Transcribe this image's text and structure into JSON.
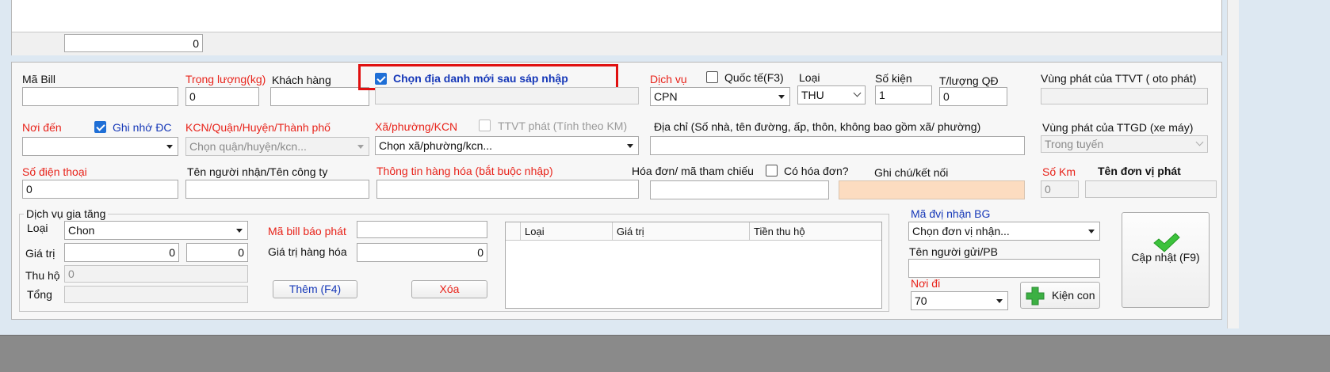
{
  "top_grid": {
    "count_value": "0"
  },
  "header": {
    "ma_bill": {
      "label": "Mã Bill",
      "value": ""
    },
    "trong_luong": {
      "label": "Trọng lượng(kg)",
      "value": "0"
    },
    "khach_hang": {
      "label": "Khách hàng",
      "value": ""
    },
    "chon_dia_danh": {
      "label": "Chọn địa danh mới sau sáp nhập",
      "checked": true
    },
    "dich_vu": {
      "label": "Dịch vụ",
      "value": "CPN"
    },
    "quoc_te": {
      "label": "Quốc tế(F3)",
      "checked": false
    },
    "loai": {
      "label": "Loại",
      "value": "THU"
    },
    "so_kien": {
      "label": "Số kiện",
      "value": "1"
    },
    "tluong_qd": {
      "label": "T/lượng QĐ",
      "value": "0"
    },
    "vung_phat_ttvt": {
      "label": "Vùng phát của TTVT ( oto phát)",
      "value": ""
    }
  },
  "row2": {
    "noi_den": {
      "label": "Nơi đến",
      "value": ""
    },
    "ghi_nho_dc": {
      "label": "Ghi nhớ ĐC",
      "checked": true
    },
    "kcn": {
      "label": "KCN/Quận/Huyện/Thành phố",
      "placeholder": "Chọn quận/huyện/kcn..."
    },
    "xa_phuong": {
      "label": "Xã/phường/KCN",
      "placeholder": "Chọn xã/phường/kcn..."
    },
    "ttvt_phat": {
      "label": "TTVT phát (Tính theo KM)",
      "checked": false
    },
    "dia_chi": {
      "label": "Địa chỉ (Số nhà, tên đường, ấp, thôn, không bao gồm xã/ phường)",
      "value": ""
    },
    "vung_phat_ttgd": {
      "label": "Vùng phát của TTGD (xe máy)",
      "value": "Trong tuyến"
    }
  },
  "row3": {
    "so_dien_thoai": {
      "label": "Số điện thoại",
      "value": "0"
    },
    "ten_nguoi_nhan": {
      "label": "Tên người nhận/Tên công ty",
      "value": ""
    },
    "thong_tin_hang_hoa": {
      "label": "Thông tin hàng hóa (bắt buộc nhập)",
      "value": ""
    },
    "hoa_don": {
      "label": "Hóa đơn/ mã tham chiếu",
      "value": ""
    },
    "co_hoa_don": {
      "label": "Có hóa đơn?",
      "checked": false
    },
    "ghi_chu": {
      "label": "Ghi chú/kết nối",
      "value": ""
    },
    "so_km": {
      "label": "Số Km",
      "value": "0"
    },
    "ten_don_vi_phat": {
      "label": "Tên đơn vị phát",
      "value": ""
    }
  },
  "dich_vu_gia_tang": {
    "title": "Dịch vụ gia tăng",
    "loai_label": "Loại",
    "loai_value": "Chon",
    "gia_tri_label": "Giá trị",
    "gia_tri_value1": "0",
    "gia_tri_value2": "0",
    "thu_ho_label": "Thu hộ",
    "thu_ho_value": "0",
    "tong_label": "Tổng",
    "tong_value": "",
    "ma_bill_bao_phat_label": "Mã bill báo phát",
    "ma_bill_bao_phat_value": "",
    "gia_tri_hang_hoa_label": "Giá trị hàng hóa",
    "gia_tri_hang_hoa_value": "0",
    "them_button": "Thêm (F4)",
    "xoa_button": "Xóa",
    "table": {
      "columns": [
        "Loại",
        "Giá trị",
        "Tiền thu hộ"
      ]
    }
  },
  "right_panel": {
    "ma_dvi_nhan_bg": {
      "label": "Mã đvị nhận BG",
      "placeholder": "Chọn đơn vị nhận..."
    },
    "ten_nguoi_gui": {
      "label": "Tên người gửi/PB",
      "value": ""
    },
    "noi_di": {
      "label": "Nơi đi",
      "value": "70"
    },
    "kien_con_button": "Kiện con",
    "cap_nhat_button": "Cập nhật (F9)"
  },
  "colors": {
    "required_label": "#e8231a",
    "link_label": "#1638b8",
    "highlight_border": "#e01010",
    "note_field": "#fcdcc0",
    "checkbox": "#1f6fd6"
  }
}
